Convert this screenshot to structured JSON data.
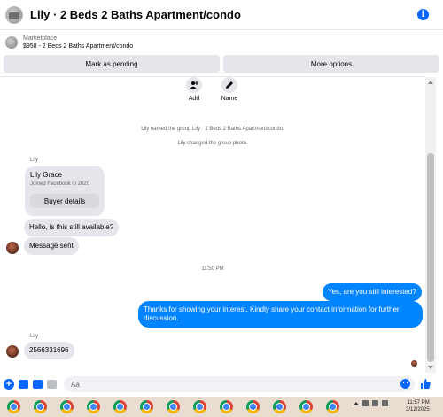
{
  "header": {
    "title": "Lily · 2 Beds 2 Baths Apartment/condo",
    "info_icon": "info-icon"
  },
  "marketplace": {
    "label": "Marketplace",
    "item": "$958 - 2 Beds 2 Baths Apartment/condo"
  },
  "actions": {
    "mark_pending": "Mark as pending",
    "more_options": "More options"
  },
  "top_actions": {
    "add_label": "Add",
    "name_label": "Name"
  },
  "system_messages": [
    "Lily named the group Lily · 2 Beds 2 Baths Apartment/condo.",
    "Lily changed the group photo."
  ],
  "thread": {
    "sender_1": "Lily",
    "profile_card": {
      "name": "Lily Grace",
      "joined": "Joined Facebook in 2020",
      "button": "Buyer details"
    },
    "msg_available": "Hello, is this still available?",
    "msg_sent": "Message sent",
    "time_divider": "11:50 PM",
    "reply_1": "Yes, are you still interested?",
    "reply_2": "Thanks for showing your interest. Kindly share your contact information for further discussion.",
    "sender_2": "Lily",
    "msg_number": "2566331696"
  },
  "composer": {
    "placeholder": "Aa"
  },
  "taskbar": {
    "time": "11:57 PM",
    "date": "3/12/2025",
    "app_count": 13,
    "colors": {
      "accent": "#0866ff",
      "bubble_me": "#0084ff",
      "bubble_them": "#e4e6eb",
      "taskbar_bg": "#e8ddd0"
    }
  }
}
